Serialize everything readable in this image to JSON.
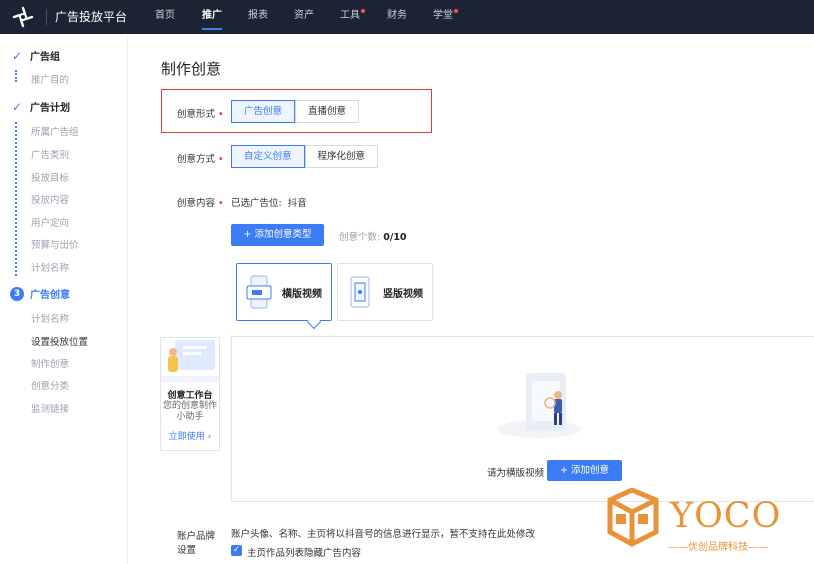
{
  "nav": {
    "brand": "广告投放平台",
    "items": [
      "首页",
      "推广",
      "报表",
      "资产",
      "工具",
      "财务",
      "学堂"
    ],
    "active": "推广"
  },
  "sidebar": {
    "step1": "广告组",
    "step1_sub": [
      "推广目的"
    ],
    "step2": "广告计划",
    "step2_sub": [
      "所属广告组",
      "广告类别",
      "投放目标",
      "投放内容",
      "用户定向",
      "预算与出价",
      "计划名称"
    ],
    "step3_num": "3",
    "step3": "广告创意",
    "step3_sub": [
      "计划名称",
      "设置投放位置",
      "制作创意",
      "创意分类",
      "监测链接"
    ]
  },
  "main": {
    "title": "制作创意",
    "form_label": "创意形式",
    "form_options": [
      "广告创意",
      "直播创意"
    ],
    "method_label": "创意方式",
    "method_options": [
      "自定义创意",
      "程序化创意"
    ],
    "content_label": "创意内容",
    "placement_prefix": "已选广告位:",
    "placement_value": "抖音",
    "add_type_button": "+ 添加创意类型",
    "count_label": "创意个数:",
    "count_value": "0/10",
    "type_cards": [
      "横版视频",
      "竖版视频"
    ],
    "workbench": {
      "title": "创意工作台",
      "desc": "您的创意制作小助手",
      "link": "立即使用 ›"
    },
    "preview_prompt": "请为横版视频",
    "add_creative_button": "+ 添加创意",
    "brand_label": "账户品牌设置",
    "brand_desc": "账户头像、名称、主页将以抖音号的信息进行显示，暂不支持在此处修改",
    "brand_checkbox": "主页作品列表隐藏广告内容"
  },
  "watermark": {
    "text": "YOCO",
    "sub": "——优创品牌科技——"
  }
}
